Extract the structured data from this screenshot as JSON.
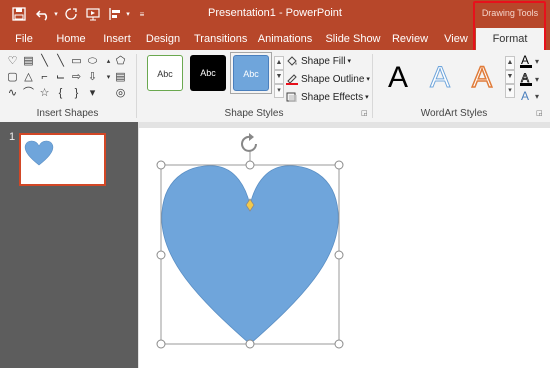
{
  "window": {
    "title": "Presentation1 - PowerPoint",
    "contextual_group": "Drawing Tools"
  },
  "tabs": [
    {
      "label": "File"
    },
    {
      "label": "Home"
    },
    {
      "label": "Insert"
    },
    {
      "label": "Design"
    },
    {
      "label": "Transitions"
    },
    {
      "label": "Animations"
    },
    {
      "label": "Slide Show"
    },
    {
      "label": "Review"
    },
    {
      "label": "View"
    },
    {
      "label": "Format",
      "selected": true
    }
  ],
  "ribbon": {
    "insert_shapes": {
      "label": "Insert Shapes"
    },
    "shape_styles": {
      "label": "Shape Styles",
      "swatches": [
        {
          "label": "Abc"
        },
        {
          "label": "Abc"
        },
        {
          "label": "Abc"
        }
      ],
      "fill_label": "Shape Fill",
      "outline_label": "Shape Outline",
      "effects_label": "Shape Effects"
    },
    "wordart_styles": {
      "label": "WordArt Styles",
      "samples": [
        "A",
        "A",
        "A"
      ]
    }
  },
  "slides": {
    "number": "1"
  },
  "colors": {
    "accent": "#b7472a",
    "heart_fill": "#6fa5db",
    "highlight": "#e8101b"
  }
}
